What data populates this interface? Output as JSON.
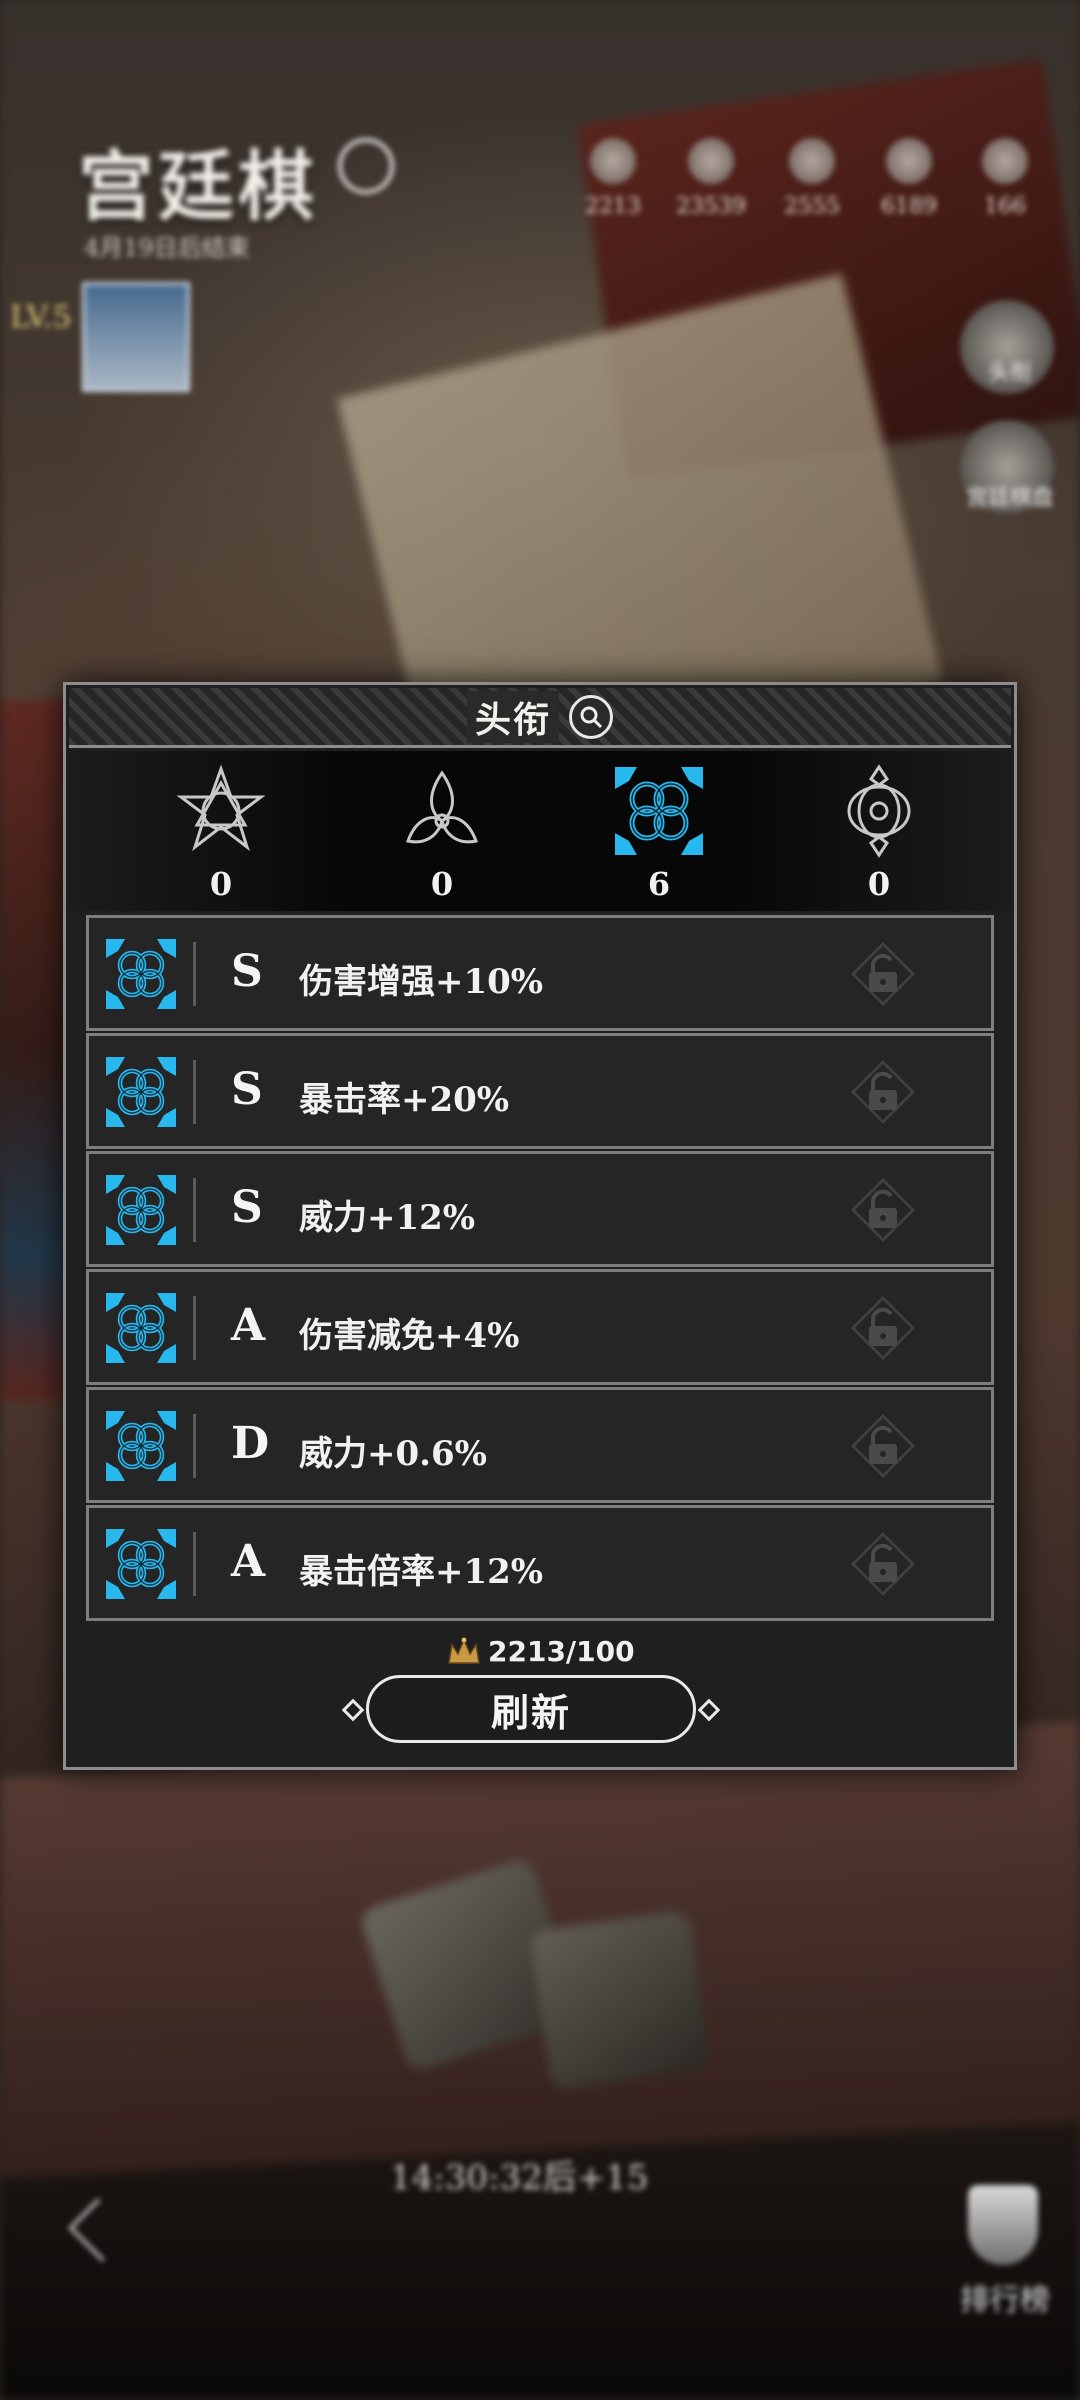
{
  "background": {
    "title": "宫廷棋",
    "subtitle": "4月19日后结束",
    "level": "LV.5",
    "resources": [
      {
        "icon": "crown-icon",
        "value": "2213"
      },
      {
        "icon": "horse-icon",
        "value": "23539"
      },
      {
        "icon": "helmet-icon",
        "value": "2555"
      },
      {
        "icon": "feather-icon",
        "value": "6189"
      },
      {
        "icon": "egg-icon",
        "value": "166"
      }
    ],
    "side_buttons": [
      {
        "label": "头衔"
      },
      {
        "label": "宫廷棋盘"
      }
    ],
    "timer": "14:30:32后+15",
    "leaderboard_label": "排行榜"
  },
  "panel": {
    "title": "头衔",
    "badges": [
      {
        "icon": "star-emblem-icon",
        "count": "0",
        "color": "#bdbdbd"
      },
      {
        "icon": "trefoil-emblem-icon",
        "count": "0",
        "color": "#bdbdbd"
      },
      {
        "icon": "knot-emblem-icon",
        "count": "6",
        "color": "#29b8ee"
      },
      {
        "icon": "ring-emblem-icon",
        "count": "0",
        "color": "#bdbdbd"
      }
    ],
    "titles": [
      {
        "grade": "S",
        "effect": "伤害增强+10%"
      },
      {
        "grade": "S",
        "effect": "暴击率+20%"
      },
      {
        "grade": "S",
        "effect": "威力+12%"
      },
      {
        "grade": "A",
        "effect": "伤害减免+4%"
      },
      {
        "grade": "D",
        "effect": "威力+0.6%"
      },
      {
        "grade": "A",
        "effect": "暴击倍率+12%"
      }
    ],
    "cost": "2213/100",
    "refresh_label": "刷新"
  },
  "colors": {
    "accent": "#29b8ee",
    "panel_bg": "#1f1f1f",
    "row_border": "#7d7d7d"
  }
}
